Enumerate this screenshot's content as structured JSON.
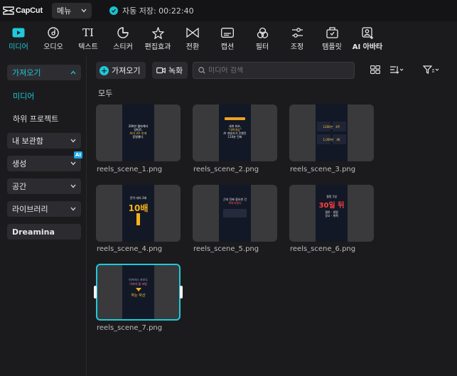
{
  "app": {
    "logo_text": "CapCut",
    "menu_label": "메뉴",
    "save_status": "자동 저장: 00:22:40"
  },
  "toolbar": [
    {
      "label": "미디어",
      "icon": "media-icon",
      "active": true
    },
    {
      "label": "오디오",
      "icon": "audio-icon"
    },
    {
      "label": "텍스트",
      "icon": "text-icon"
    },
    {
      "label": "스티커",
      "icon": "sticker-icon"
    },
    {
      "label": "편집효과",
      "icon": "effects-icon"
    },
    {
      "label": "전환",
      "icon": "transition-icon"
    },
    {
      "label": "캡션",
      "icon": "caption-icon"
    },
    {
      "label": "필터",
      "icon": "filter-icon"
    },
    {
      "label": "조정",
      "icon": "adjust-icon"
    },
    {
      "label": "템플릿",
      "icon": "template-icon"
    },
    {
      "label": "AI 아바타",
      "icon": "ai-avatar-icon"
    }
  ],
  "sidebar": {
    "import": "가져오기",
    "media": "미디어",
    "sub_project": "하위 프로젝트",
    "library": "내 보관함",
    "generate": "생성",
    "generate_badge": "AI",
    "space": "공간",
    "library2": "라이브러리",
    "dreamina": "Dreamina"
  },
  "main": {
    "import_btn": "가져오기",
    "record_btn": "녹화",
    "search_placeholder": "미디어 검색",
    "section_title": "모두",
    "files": [
      {
        "name": "reels_scene_1.png",
        "thumb_text": "200만 월마케터 양피트, AI가 4주 만에 증명했다."
      },
      {
        "name": "reels_scene_2.png",
        "thumb_text": "세계 최초, \"대박영상\" AI 개발자가 진행된 110분 진짜"
      },
      {
        "name": "reels_scene_3.png",
        "thumb_text": "1200만 / 4주 / 1,000만 / 4K"
      },
      {
        "name": "reels_scene_4.png",
        "thumb_text": "10배"
      },
      {
        "name": "reels_scene_5.png",
        "thumb_text": "근데 진짜 중요한 게 뭐였는데"
      },
      {
        "name": "reels_scene_6.png",
        "thumb_text": "30일 뒤"
      },
      {
        "name": "reels_scene_7.png",
        "thumb_text": "이커머 할 비법 · 하는 자산"
      }
    ]
  },
  "colors": {
    "accent": "#20c9da",
    "bg": "#1b1b1d",
    "topbar": "#141416"
  }
}
